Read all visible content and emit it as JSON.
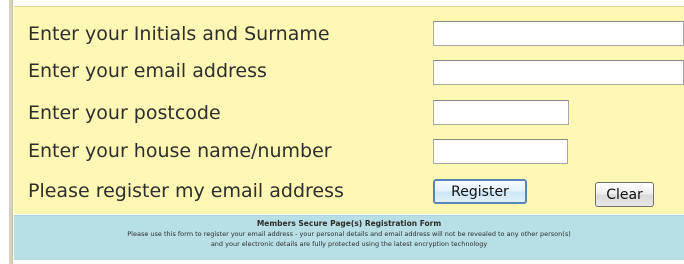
{
  "form": {
    "initials_surname_label": "Enter your Initials and Surname",
    "email_label": "Enter your email address",
    "postcode_label": "Enter your postcode",
    "house_label": "Enter your house name/number",
    "register_prompt": "Please register my email address",
    "initials_surname_value": "",
    "email_value": "",
    "postcode_value": "",
    "house_value": "",
    "register_button": "Register",
    "clear_button": "Clear"
  },
  "info": {
    "title": "Members Secure Page(s) Registration Form",
    "line1": "Please use this form to register your email address - your personal details and email address will not be revealed to any other person(s)",
    "line2": "and your electronic details are fully protected using the latest encryption technology"
  },
  "colors": {
    "form_background": "#fff7b4",
    "info_background": "#b8dfe6",
    "register_border": "#5a84b6"
  }
}
